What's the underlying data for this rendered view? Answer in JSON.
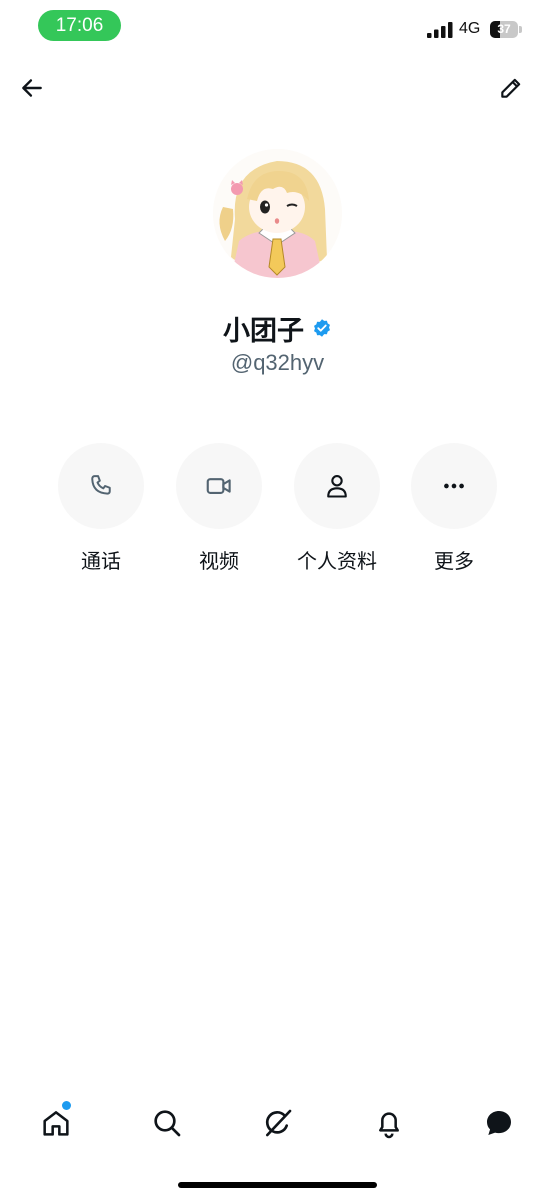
{
  "status_bar": {
    "time": "17:06",
    "network": "4G",
    "battery_level": "37",
    "battery_fraction": 0.37,
    "signal_icon": "cellular-signal-icon"
  },
  "nav": {
    "back_icon": "arrow-left-icon",
    "edit_icon": "pencil-icon"
  },
  "profile": {
    "name": "小团子",
    "handle": "@q32hyv",
    "verified": true,
    "verified_color": "#1d9bf0",
    "avatar_icon": "anime-girl-avatar"
  },
  "actions": [
    {
      "label": "通话",
      "icon": "phone-icon"
    },
    {
      "label": "视频",
      "icon": "video-camera-icon"
    },
    {
      "label": "个人资料",
      "icon": "person-icon"
    },
    {
      "label": "更多",
      "icon": "more-dots-icon"
    }
  ],
  "tabs": [
    {
      "icon": "home-icon",
      "has_badge": true
    },
    {
      "icon": "search-icon"
    },
    {
      "icon": "grok-icon"
    },
    {
      "icon": "bell-icon"
    },
    {
      "icon": "messages-icon"
    }
  ],
  "colors": {
    "accent": "#1d9bf0",
    "time_pill": "#34c759",
    "secondary_text": "#536471",
    "action_bg": "#f7f7f7"
  }
}
